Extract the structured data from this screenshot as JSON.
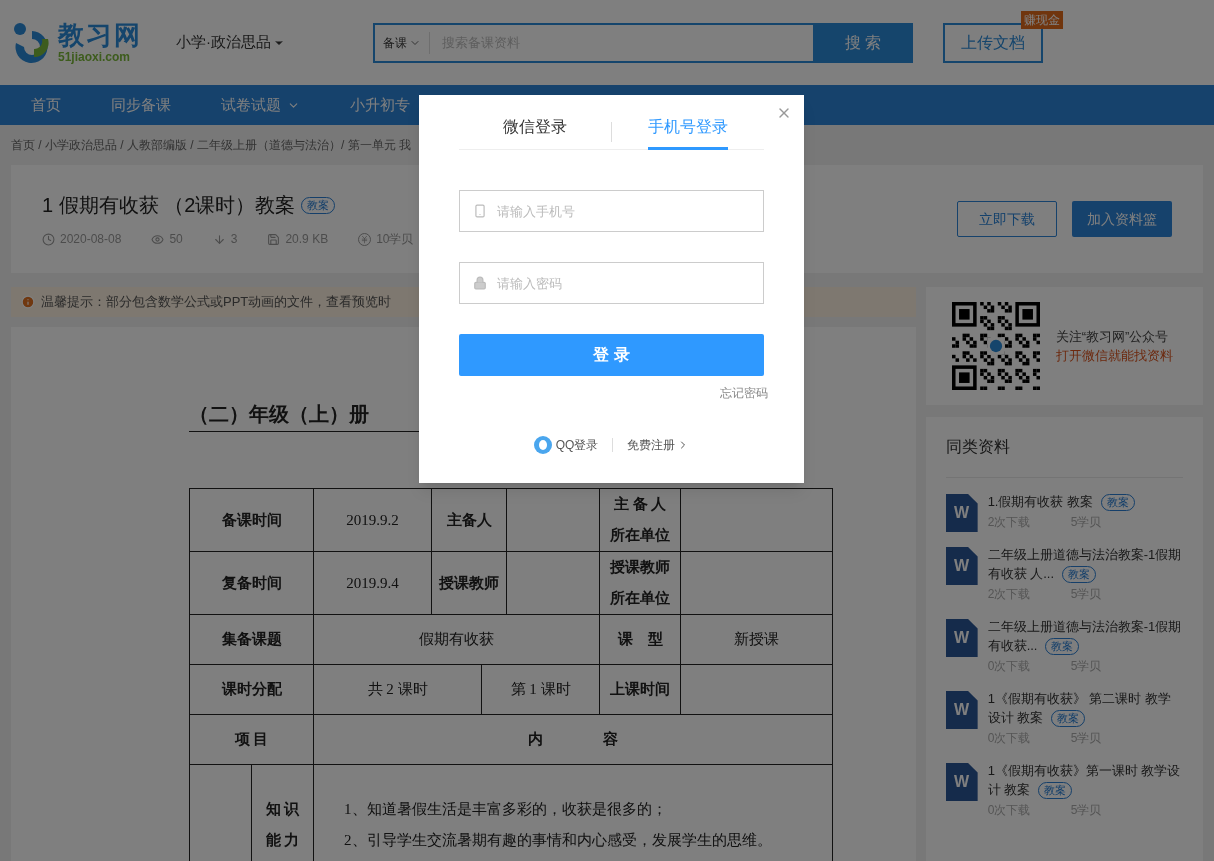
{
  "header": {
    "logo_text": "教习网",
    "logo_sub": "51jiaoxi.com",
    "subject": "小学·政治思品",
    "search": {
      "category": "备课",
      "placeholder": "搜索备课资料",
      "button": "搜 索"
    },
    "upload": "上传文档",
    "upload_badge": "赚现金"
  },
  "nav": [
    {
      "label": "首页",
      "dropdown": false
    },
    {
      "label": "同步备课",
      "dropdown": false
    },
    {
      "label": "试卷试题",
      "dropdown": true
    },
    {
      "label": "小升初专",
      "dropdown": false
    }
  ],
  "breadcrumb": "首页 / 小学政治思品 / 人教部编版 / 二年级上册（道德与法治）/ 第一单元 我",
  "doc": {
    "title": "1 假期有收获 （2课时）教案",
    "tag": "教案",
    "meta": [
      {
        "kind": "date",
        "text": "2020-08-08"
      },
      {
        "kind": "views",
        "text": "50"
      },
      {
        "kind": "downloads",
        "text": "3"
      },
      {
        "kind": "size",
        "text": "20.9 KB"
      },
      {
        "kind": "price",
        "text": "10学贝"
      }
    ],
    "buttons": [
      {
        "label": "立即下载",
        "kind": "outline"
      },
      {
        "label": "加入资料篮",
        "kind": "solid"
      }
    ]
  },
  "notice": "温馨提示：部分包含数学公式或PPT动画的文件，查看预览时",
  "preview": {
    "heading": "（二）年级（上）册",
    "rows": [
      [
        {
          "kind": "label",
          "lines": [
            "备课时间"
          ],
          "colspan": 2
        },
        {
          "kind": "value",
          "lines": [
            "2019.9.2"
          ]
        },
        {
          "kind": "label",
          "lines": [
            "主备人"
          ],
          "colspan": 2
        },
        {
          "kind": "value"
        },
        {
          "kind": "label",
          "lines": [
            "主 备 人",
            "所在单位"
          ]
        },
        {
          "kind": "value"
        }
      ],
      [
        {
          "kind": "label",
          "lines": [
            "复备时间"
          ],
          "colspan": 2
        },
        {
          "kind": "value",
          "lines": [
            "2019.9.4"
          ]
        },
        {
          "kind": "label",
          "lines": [
            "授课教师"
          ],
          "colspan": 2
        },
        {
          "kind": "value"
        },
        {
          "kind": "label",
          "lines": [
            "授课教师",
            "所在单位"
          ]
        },
        {
          "kind": "value"
        }
      ],
      [
        {
          "kind": "label",
          "lines": [
            "集备课题"
          ],
          "colspan": 2
        },
        {
          "kind": "value",
          "lines": [
            "假期有收获"
          ],
          "colspan": 4
        },
        {
          "kind": "label",
          "lines": [
            "课　型"
          ]
        },
        {
          "kind": "value",
          "lines": [
            "新授课"
          ]
        }
      ],
      [
        {
          "kind": "label",
          "lines": [
            "课时分配"
          ],
          "colspan": 2
        },
        {
          "kind": "value",
          "lines": [
            "共 2 课时"
          ],
          "colspan": 2
        },
        {
          "kind": "value",
          "lines": [
            "第 1 课时"
          ],
          "colspan": 2
        },
        {
          "kind": "label",
          "lines": [
            "上课时间"
          ]
        },
        {
          "kind": "value"
        }
      ],
      [
        {
          "kind": "label",
          "lines": [
            "项 目"
          ],
          "colspan": 2
        },
        {
          "kind": "label",
          "lines": [
            "内　　　　容"
          ],
          "colspan": 6
        }
      ],
      [
        {
          "kind": "value"
        },
        {
          "kind": "label",
          "lines": [
            "知 识",
            "能 力"
          ]
        },
        {
          "kind": "text",
          "lines": [
            "1、知道暑假生活是丰富多彩的，收获是很多的；",
            "2、引导学生交流暑期有趣的事情和内心感受，发展学生的思维。"
          ],
          "colspan": 6
        }
      ]
    ]
  },
  "sidebar": {
    "qr": {
      "line1": "关注“教习网”公众号",
      "line2": "打开微信就能找资料"
    },
    "related": {
      "title": "同类资料",
      "items": [
        {
          "icon": "W",
          "title": "1.假期有收获 教案",
          "tag": "教案",
          "downloads": "2次下载",
          "price": "5学贝"
        },
        {
          "icon": "W",
          "title": "二年级上册道德与法治教案-1假期有收获 人...",
          "tag": "教案",
          "downloads": "2次下载",
          "price": "5学贝"
        },
        {
          "icon": "W",
          "title": "二年级上册道德与法治教案-1假期有收获...",
          "tag": "教案",
          "downloads": "0次下载",
          "price": "5学贝"
        },
        {
          "icon": "W",
          "title": "1《假期有收获》 第二课时 教学设计 教案",
          "tag": "教案",
          "downloads": "0次下载",
          "price": "5学贝"
        },
        {
          "icon": "W",
          "title": "1《假期有收获》第一课时 教学设计 教案",
          "tag": "教案",
          "downloads": "0次下载",
          "price": "5学贝"
        }
      ]
    }
  },
  "modal": {
    "tabs": [
      {
        "label": "微信登录",
        "selected": false
      },
      {
        "label": "手机号登录",
        "selected": true
      }
    ],
    "phone_placeholder": "请输入手机号",
    "password_placeholder": "请输入密码",
    "login": "登 录",
    "forgot": "忘记密码",
    "qq": "QQ登录",
    "register": "免费注册"
  }
}
